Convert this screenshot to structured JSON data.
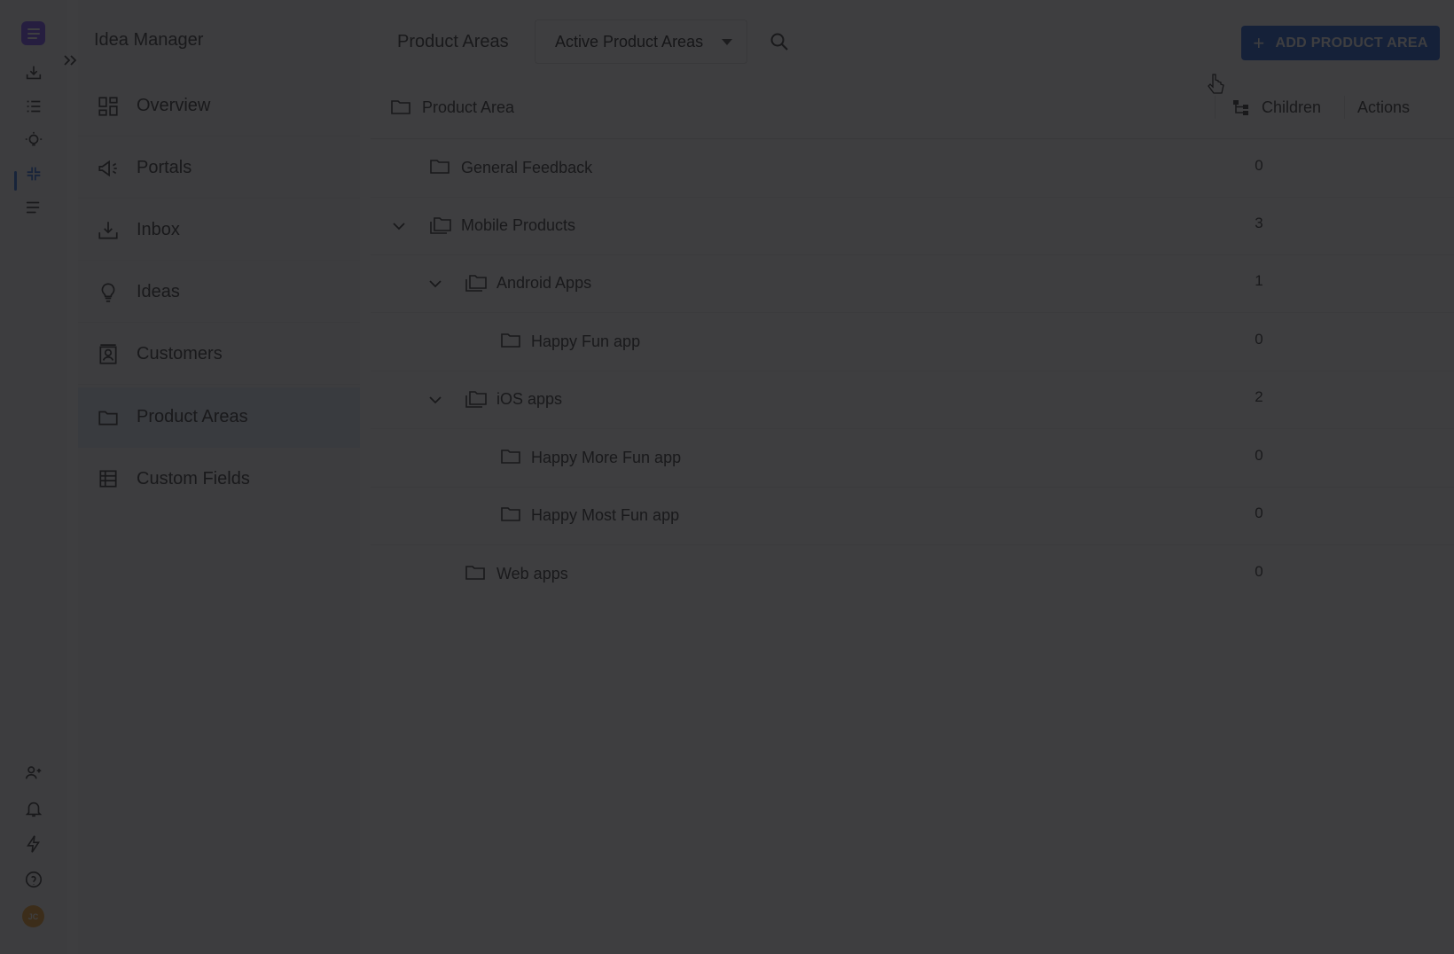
{
  "app": {
    "section_title": "Idea Manager"
  },
  "rail": {
    "items": [
      {
        "name": "logo-icon"
      },
      {
        "name": "inbox-icon"
      },
      {
        "name": "list-icon"
      },
      {
        "name": "ideas-icon"
      },
      {
        "name": "product-areas-icon"
      },
      {
        "name": "roadmap-icon"
      },
      {
        "name": "users-icon"
      },
      {
        "name": "bell-icon"
      },
      {
        "name": "lightning-icon"
      },
      {
        "name": "help-icon"
      }
    ],
    "avatar_initials": "JC"
  },
  "nav": {
    "items": [
      {
        "label": "Overview",
        "icon": "overview-icon"
      },
      {
        "label": "Portals",
        "icon": "megaphone-icon"
      },
      {
        "label": "Inbox",
        "icon": "inbox-icon"
      },
      {
        "label": "Ideas",
        "icon": "lightbulb-icon"
      },
      {
        "label": "Customers",
        "icon": "customers-icon"
      },
      {
        "label": "Product Areas",
        "icon": "folder-icon",
        "active": true
      },
      {
        "label": "Custom Fields",
        "icon": "custom-fields-icon"
      }
    ]
  },
  "toolbar": {
    "title": "Product Areas",
    "filter_value": "Active Product Areas",
    "add_label": "ADD PRODUCT AREA"
  },
  "table": {
    "headers": {
      "area": "Product Area",
      "children": "Children",
      "actions": "Actions"
    },
    "rows": [
      {
        "name": "General Feedback",
        "children": "0",
        "level": 1,
        "expandable": false
      },
      {
        "name": "Mobile Products",
        "children": "3",
        "level": 1,
        "expandable": true
      },
      {
        "name": "Android Apps",
        "children": "1",
        "level": 2,
        "expandable": true
      },
      {
        "name": "Happy Fun app",
        "children": "0",
        "level": 3,
        "expandable": false
      },
      {
        "name": "iOS apps",
        "children": "2",
        "level": 2,
        "expandable": true
      },
      {
        "name": "Happy More Fun app",
        "children": "0",
        "level": 3,
        "expandable": false
      },
      {
        "name": "Happy Most Fun app",
        "children": "0",
        "level": 3,
        "expandable": false
      },
      {
        "name": "Web apps",
        "children": "0",
        "level": 2,
        "expandable": false
      }
    ]
  },
  "colors": {
    "accent": "#1f5fd6",
    "active_nav_bg": "#e3ebf8",
    "logo_bg": "#7c4dff",
    "avatar_bg": "#f3a22c",
    "overlay": "#141416"
  }
}
